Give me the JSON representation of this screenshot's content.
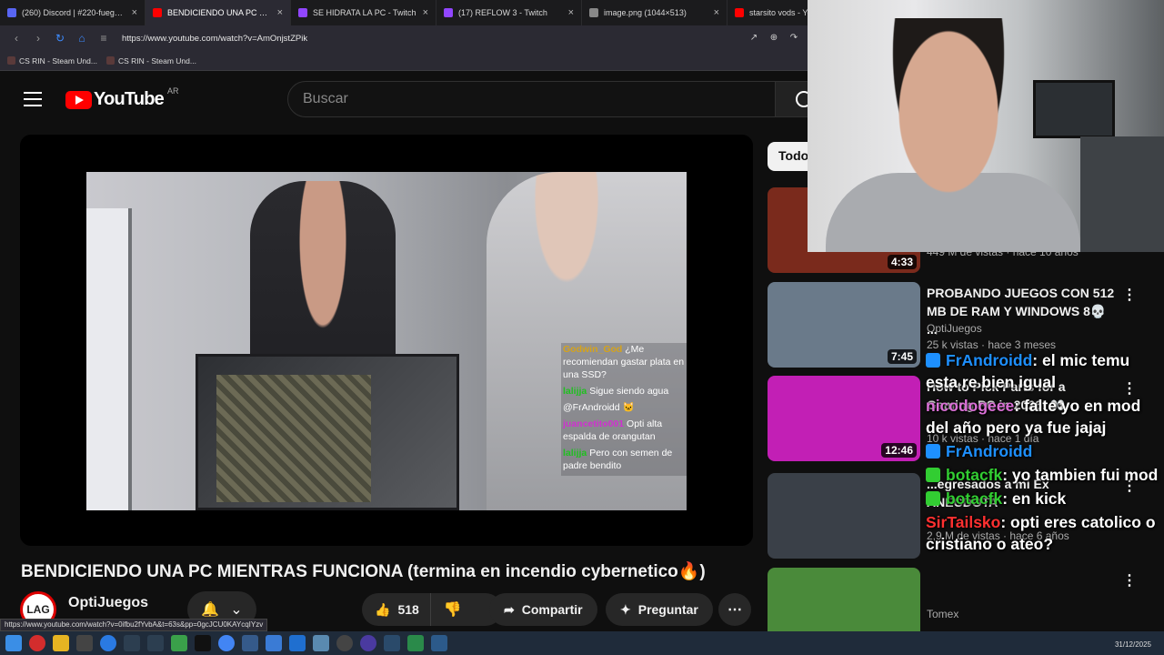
{
  "browser": {
    "tabs": [
      {
        "title": "(260) Discord | #220-fuego-de",
        "fav_color": "#5865F2",
        "active": false
      },
      {
        "title": "BENDICIENDO UNA PC MIE",
        "fav_color": "#ff0000",
        "active": true
      },
      {
        "title": "SE HIDRATA LA PC - Twitch",
        "fav_color": "#9146FF",
        "active": false
      },
      {
        "title": "(17) REFLOW 3 - Twitch",
        "fav_color": "#9146FF",
        "active": false
      },
      {
        "title": "image.png (1044×513)",
        "fav_color": "#888888",
        "active": false
      },
      {
        "title": "starsito vods - You",
        "fav_color": "#ff0000",
        "active": false
      }
    ],
    "url": "https://www.youtube.com/watch?v=AmOnjstZPik",
    "bookmarks": [
      "CS RIN - Steam Und...",
      "CS RIN - Steam Und..."
    ],
    "status_url": "https://www.youtube.com/watch?v=0ifbu2fYvbA&t=63s&pp=0gcJCU0KAYcqIYzv"
  },
  "youtube": {
    "logo_text": "YouTube",
    "country_code": "AR",
    "search_placeholder": "Buscar",
    "video_title": "BENDICIENDO UNA PC MIENTRAS FUNCIONA (termina en incendio cybernetico🔥)",
    "channel": {
      "name": "OptiJuegos",
      "avatar_text": "LAG"
    },
    "actions": {
      "likes": "518",
      "share": "Compartir",
      "ask": "Preguntar"
    },
    "chip_label": "Todo",
    "recommendations": [
      {
        "title": "",
        "channel": "",
        "meta": "449 M de vistas · hace 10 años",
        "duration": "4:33",
        "thumb_color": "#7a2a1c"
      },
      {
        "title": "PROBANDO JUEGOS CON 512 MB DE RAM Y WINDOWS 8💀 ...",
        "channel": "OptiJuegos",
        "meta": "25 k vistas · hace 3 meses",
        "duration": "7:45",
        "thumb_color": "#6a7a8a"
      },
      {
        "title": "How to Pick Parts for a Gaming PC in 2026! 👀",
        "channel": "",
        "meta": "10 k vistas · hace 1 día",
        "duration": "12:46",
        "thumb_color": "#c21fb5"
      },
      {
        "title": "...egresados a mi Ex ANECDOTA",
        "channel": "",
        "meta": "2,9 M de vistas · hace 6 años",
        "duration": "",
        "thumb_color": "#3a4048"
      },
      {
        "title": "",
        "channel": "Tomex",
        "meta": "",
        "duration": "",
        "thumb_color": "#4a8a3a"
      }
    ]
  },
  "video_overlay_chat": [
    {
      "user": "Godwin_God",
      "text": "¿Me recomiendan gastar plata en una SSD?",
      "color": "#d6a31a"
    },
    {
      "user": "lalijja",
      "text": "Sigue siendo agua",
      "color": "#20c020"
    },
    {
      "user": "",
      "text": "@FrAndroidd 🐱",
      "color": "#b030d0"
    },
    {
      "user": "juancetito001",
      "text": "Opti alta espalda de orangutan",
      "color": "#d030d0"
    },
    {
      "user": "lalijja",
      "text": "Pero con semen de padre bendito",
      "color": "#20c020"
    }
  ],
  "stream_chat": [
    {
      "user": "FrAndroidd",
      "text": ": el mic temu esta re bien igual",
      "color": "#1e90ff",
      "badge": "#1e90ff"
    },
    {
      "user": "nicodogeee",
      "text": ": falte yo en mod del año pero ya fue jajaj",
      "color": "#da70d6",
      "badge": ""
    },
    {
      "user": "FrAndroidd",
      "text": "",
      "color": "#1e90ff",
      "badge": "#1e90ff"
    },
    {
      "user": "botacfk",
      "text": ": yo tambien fui mod",
      "color": "#32cd32",
      "badge": "#32cd32"
    },
    {
      "user": "botacfk",
      "text": ": en kick",
      "color": "#32cd32",
      "badge": "#32cd32"
    },
    {
      "user": "SirTailsko",
      "text": ": opti eres catolico o cristiano o ateo?",
      "color": "#ff3030",
      "badge": ""
    }
  ],
  "taskbar": {
    "clock": "31/12/2025"
  }
}
